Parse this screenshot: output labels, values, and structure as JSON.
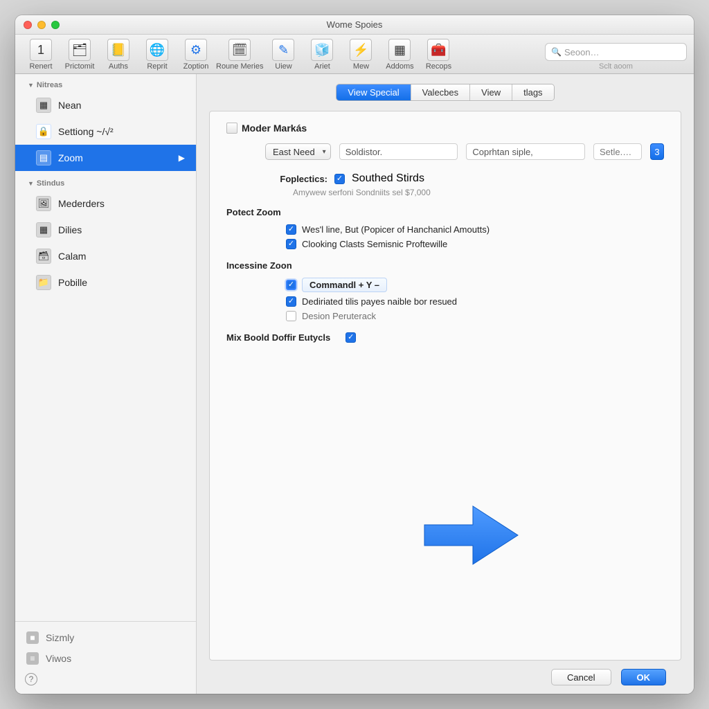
{
  "window": {
    "title": "Wome Spoies"
  },
  "toolbar": {
    "items": [
      {
        "label": "Renert",
        "glyph": "1"
      },
      {
        "label": "Prictomit",
        "glyph": "🗂"
      },
      {
        "label": "Auths",
        "glyph": "📒"
      },
      {
        "label": "Reprit",
        "glyph": "🌐"
      },
      {
        "label": "Zoption",
        "glyph": "⚙"
      },
      {
        "label": "Roune Meries",
        "glyph": "🗓"
      },
      {
        "label": "Uiew",
        "glyph": "✎"
      },
      {
        "label": "Ariet",
        "glyph": "🧊"
      },
      {
        "label": "Mew",
        "glyph": "⚡"
      },
      {
        "label": "Addoms",
        "glyph": "▦"
      },
      {
        "label": "Recops",
        "glyph": "🧰"
      }
    ],
    "search_placeholder": "Seoon…",
    "search_sublabel": "Sclt aoom"
  },
  "sidebar": {
    "sections": [
      {
        "title": "Nitreas",
        "items": [
          {
            "label": "Nean",
            "glyph": "▦"
          },
          {
            "label": "Settiong ~/√²",
            "glyph": "lock"
          },
          {
            "label": "Zoom",
            "glyph": "▤",
            "selected": true
          }
        ]
      },
      {
        "title": "Stindus",
        "items": [
          {
            "label": "Mederders",
            "glyph": "🖼"
          },
          {
            "label": "Dilies",
            "glyph": "▦"
          },
          {
            "label": "Calam",
            "glyph": "🗃"
          },
          {
            "label": "Pobille",
            "glyph": "folder"
          }
        ]
      }
    ],
    "bottom": [
      {
        "label": "Sizmly",
        "glyph": "■"
      },
      {
        "label": "Viwos",
        "glyph": "≡"
      }
    ]
  },
  "tabs": [
    "View Special",
    "Valecbes",
    "View",
    "tlags"
  ],
  "tabs_active_index": 0,
  "panel": {
    "title": "Moder Markás",
    "select_value": "East Need",
    "tf1": "Soldistor.",
    "tf2": "Coprhtan siple,",
    "tf3": "Setle.…",
    "stepper_value": "3",
    "foplectics_label": "Foplectics:",
    "fop_check_label": "Southed Stirds",
    "fop_subnote": "Amywew serfoni Sondniits sel $7,000",
    "sec1_title": "Potect Zoom",
    "sec1_checks": [
      "Wes'l line, But (Popicer of Hanchanicl Amoutts)",
      "Clooking Clasts Semisnic Proftewille"
    ],
    "sec2_title": "Incessine Zoon",
    "sec2_cmd_label": "Commandl + Y –",
    "sec2_check2": "Dediriated tilis payes naible bor resued",
    "sec2_check3": "Desion Peruterack",
    "mix_label": "Mix Boold Doffir Eutycls"
  },
  "footer": {
    "cancel": "Cancel",
    "ok": "OK"
  }
}
